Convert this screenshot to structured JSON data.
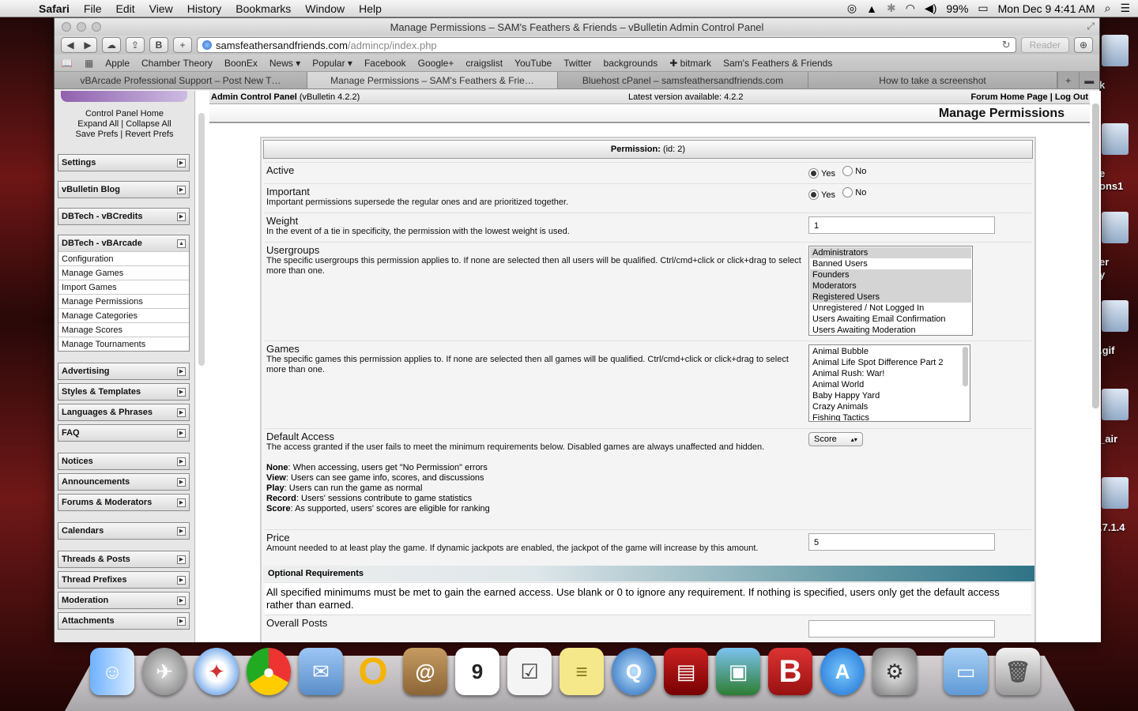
{
  "menubar": {
    "app": "Safari",
    "items": [
      "File",
      "Edit",
      "View",
      "History",
      "Bookmarks",
      "Window",
      "Help"
    ],
    "battery": "99%",
    "clock": "Mon Dec 9  4:41 AM"
  },
  "desktop_labels": [
    "k",
    "e",
    "ons1",
    "er",
    "y",
    ".gif",
    "_air",
    ".7.1.4"
  ],
  "window": {
    "title": "Manage Permissions – SAM's Feathers & Friends – vBulletin Admin Control Panel",
    "url_host": "samsfeathersandfriends.com",
    "url_path": "/admincp/index.php",
    "reader": "Reader",
    "bookmarks": [
      "Apple",
      "Chamber Theory",
      "BoonEx",
      "News ▾",
      "Popular ▾",
      "Facebook",
      "Google+",
      "craigslist",
      "YouTube",
      "Twitter",
      "backgrounds",
      "✚ bitmark",
      "Sam's Feathers & Friends"
    ],
    "tabs": [
      {
        "label": "vBArcade Professional Support – Post New T…",
        "active": false
      },
      {
        "label": "Manage Permissions – SAM's Feathers & Frie…",
        "active": true
      },
      {
        "label": "Bluehost cPanel – samsfeathersandfriends.com",
        "active": false
      },
      {
        "label": "How to take a screenshot",
        "active": false
      }
    ]
  },
  "sidebar": {
    "links": {
      "home": "Control Panel Home",
      "expand": "Expand All",
      "collapse": "Collapse All",
      "save": "Save Prefs",
      "revert": "Revert Prefs"
    },
    "groups": [
      {
        "title": "Settings"
      },
      {
        "title": "vBulletin Blog"
      },
      {
        "title": "DBTech - vBCredits"
      },
      {
        "title": "DBTech - vBArcade",
        "items": [
          "Configuration",
          "Manage Games",
          "Import Games",
          "Manage Permissions",
          "Manage Categories",
          "Manage Scores",
          "Manage Tournaments"
        ]
      },
      {
        "title": "Advertising"
      },
      {
        "title": "Styles & Templates"
      },
      {
        "title": "Languages & Phrases"
      },
      {
        "title": "FAQ"
      },
      {
        "title": "Notices"
      },
      {
        "title": "Announcements"
      },
      {
        "title": "Forums & Moderators"
      },
      {
        "title": "Calendars"
      },
      {
        "title": "Threads & Posts"
      },
      {
        "title": "Thread Prefixes"
      },
      {
        "title": "Moderation"
      },
      {
        "title": "Attachments"
      }
    ]
  },
  "header": {
    "acp": "Admin Control Panel",
    "acp_version": "(vBulletin 4.2.2)",
    "latest": "Latest version available: 4.2.2",
    "forum_home": "Forum Home Page",
    "sep": "|",
    "logout": "Log Out",
    "page_title": "Manage Permissions"
  },
  "form": {
    "heading_bold": "Permission:",
    "heading_rest": "(id: 2)",
    "yes": "Yes",
    "no": "No",
    "active_label": "Active",
    "important_label": "Important",
    "important_desc": "Important permissions supersede the regular ones and are prioritized together.",
    "weight_label": "Weight",
    "weight_desc": "In the event of a tie in specificity, the permission with the lowest weight is used.",
    "weight_value": "1",
    "usergroups_label": "Usergroups",
    "usergroups_desc": "The specific usergroups this permission applies to. If none are selected then all users will be qualified. Ctrl/cmd+click or click+drag to select more than one.",
    "usergroups": [
      {
        "name": "Administrators",
        "selected": true
      },
      {
        "name": "Banned Users",
        "selected": false
      },
      {
        "name": "Founders",
        "selected": true
      },
      {
        "name": "Moderators",
        "selected": true
      },
      {
        "name": "Registered Users",
        "selected": true
      },
      {
        "name": "Unregistered / Not Logged In",
        "selected": false
      },
      {
        "name": "Users Awaiting Email Confirmation",
        "selected": false
      },
      {
        "name": "Users Awaiting Moderation",
        "selected": false
      }
    ],
    "games_label": "Games",
    "games_desc": "The specific games this permission applies to. If none are selected then all games will be qualified. Ctrl/cmd+click or click+drag to select more than one.",
    "games": [
      "Animal Bubble",
      "Animal Life Spot Difference Part 2",
      "Animal Rush: War!",
      "Animal World",
      "Baby Happy Yard",
      "Crazy Animals",
      "Fishing Tactics"
    ],
    "default_access_label": "Default Access",
    "default_access_desc": "The access granted if the user fails to meet the minimum requirements below. Disabled games are always unaffected and hidden.",
    "default_access_value": "Score",
    "access_levels": [
      {
        "k": "None",
        "d": ": When accessing, users get \"No Permission\" errors"
      },
      {
        "k": "View",
        "d": ": Users can see game info, scores, and discussions"
      },
      {
        "k": "Play",
        "d": ": Users can run the game as normal"
      },
      {
        "k": "Record",
        "d": ": Users' sessions contribute to game statistics"
      },
      {
        "k": "Score",
        "d": ": As supported, users' scores are eligible for ranking"
      }
    ],
    "price_label": "Price",
    "price_desc": "Amount needed to at least play the game. If dynamic jackpots are enabled, the jackpot of the game will increase by this amount.",
    "price_value": "5",
    "optional_heading": "Optional Requirements",
    "optional_desc": "All specified minimums must be met to gain the earned access. Use blank or 0 to ignore any requirement. If nothing is specified, users only get the default access rather than earned.",
    "overall_posts_label": "Overall Posts"
  }
}
